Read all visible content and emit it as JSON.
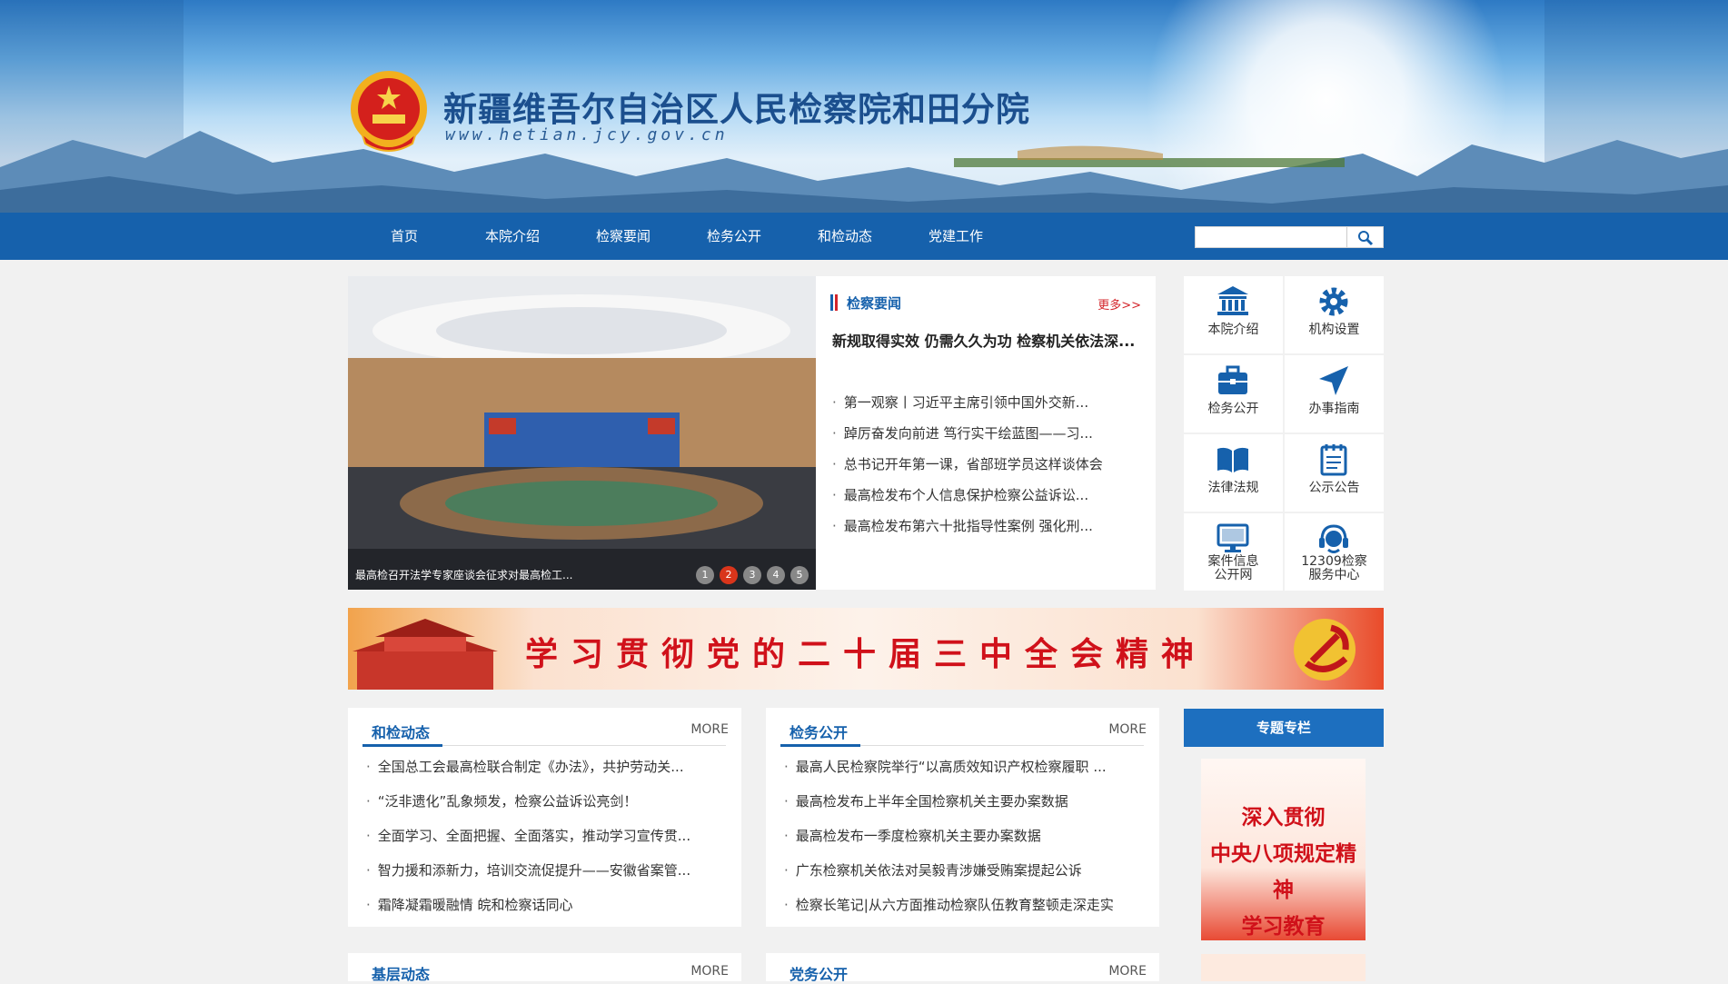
{
  "site": {
    "title": "新疆维吾尔自治区人民检察院和田分院",
    "url": "www.hetian.jcy.gov.cn"
  },
  "nav": [
    "首页",
    "本院介绍",
    "检察要闻",
    "检务公开",
    "和检动态",
    "党建工作"
  ],
  "search": {
    "placeholder": "",
    "button_icon": "search-icon"
  },
  "slider": {
    "caption": "最高检召开法学专家座谈会征求对最高检工...",
    "dots": [
      "1",
      "2",
      "3",
      "4",
      "5"
    ],
    "active_dot": 1
  },
  "news": {
    "title": "检察要闻",
    "more": "更多>>",
    "headline": "新规取得实效 仍需久久为功 检察机关依法深...",
    "items": [
      "第一观察丨习近平主席引领中国外交新...",
      "踔厉奋发向前进 笃行实干绘蓝图——习...",
      "总书记开年第一课，省部班学员这样谈体会",
      "最高检发布个人信息保护检察公益诉讼...",
      "最高检发布第六十批指导性案例 强化刑..."
    ]
  },
  "quick": [
    {
      "label": "本院介绍",
      "icon": "building-icon"
    },
    {
      "label": "机构设置",
      "icon": "gear-icon"
    },
    {
      "label": "检务公开",
      "icon": "briefcase-icon"
    },
    {
      "label": "办事指南",
      "icon": "navigation-icon"
    },
    {
      "label": "法律法规",
      "icon": "book-icon"
    },
    {
      "label": "公示公告",
      "icon": "notepad-icon"
    },
    {
      "label": "案件信息\n公开网",
      "icon": "monitor-icon"
    },
    {
      "label": "12309检察\n服务中心",
      "icon": "headset-icon"
    }
  ],
  "feature_banner": {
    "text": "学习贯彻党的二十届三中全会精神"
  },
  "panels": [
    {
      "title": "和检动态",
      "more": "MORE",
      "items": [
        "全国总工会最高检联合制定《办法》，共护劳动关...",
        "“泛非遗化”乱象频发，检察公益诉讼亮剑！",
        "全面学习、全面把握、全面落实，推动学习宣传贯...",
        "智力援和添新力，培训交流促提升——安徽省案管...",
        "霜降凝霜暖融情 皖和检察话同心"
      ]
    },
    {
      "title": "检务公开",
      "more": "MORE",
      "items": [
        "最高人民检察院举行“以高质效知识产权检察履职 ...",
        "最高检发布上半年全国检察机关主要办案数据",
        "最高检发布一季度检察机关主要办案数据",
        "广东检察机关依法对吴毅青涉嫌受贿案提起公诉",
        "检察长笔记|从六方面推动检察队伍教育整顿走深走实"
      ]
    },
    {
      "title": "基层动态",
      "more": "MORE",
      "items": []
    },
    {
      "title": "党务公开",
      "more": "MORE",
      "items": []
    }
  ],
  "special": {
    "title": "专题专栏",
    "banner_lines": [
      "深入贯彻",
      "中央八项规定精神",
      "学习教育"
    ]
  },
  "colors": {
    "primary": "#1661ac",
    "accent_red": "#d3242a"
  }
}
